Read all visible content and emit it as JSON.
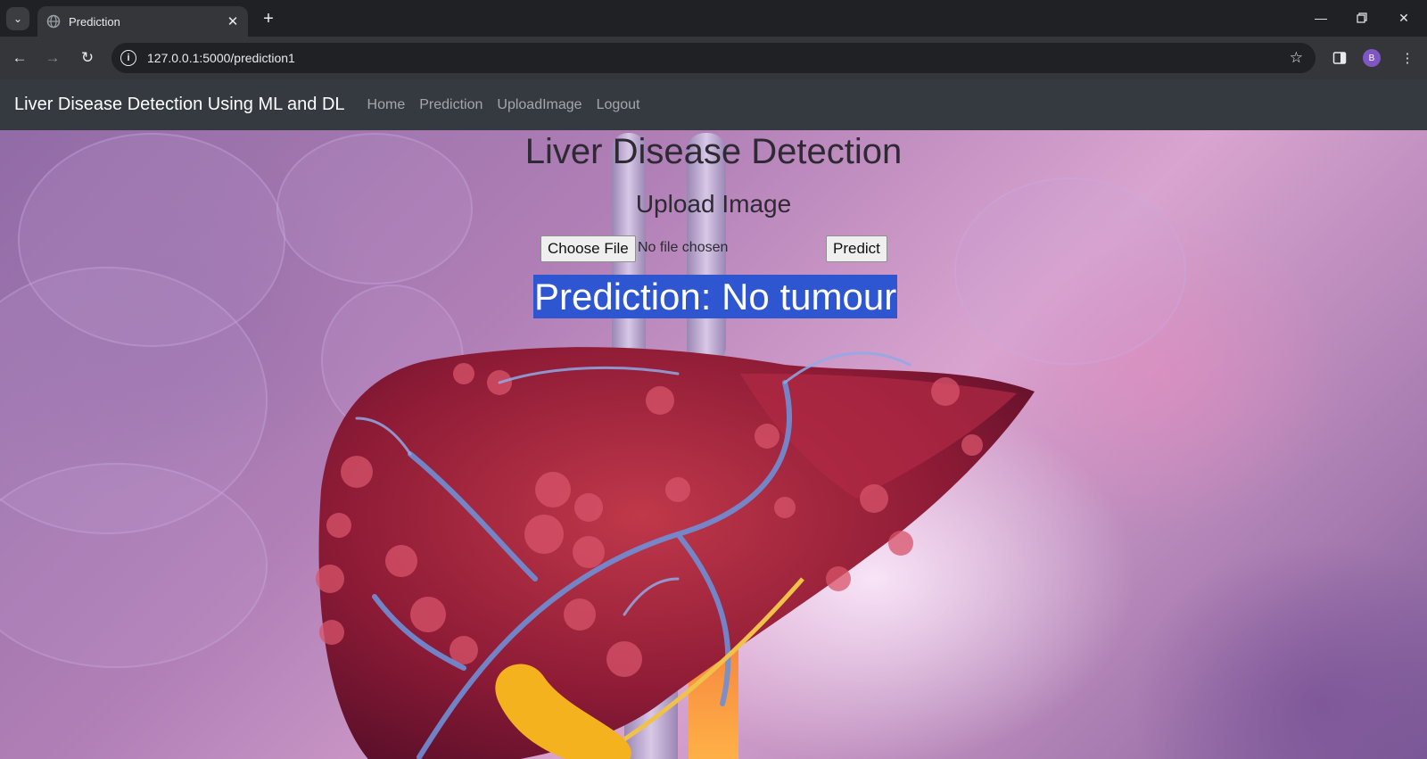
{
  "browser": {
    "tab_title": "Prediction",
    "url": "127.0.0.1:5000/prediction1",
    "profile_initial": "B"
  },
  "navbar": {
    "brand": "Liver Disease Detection Using ML and DL",
    "links": [
      "Home",
      "Prediction",
      "UploadImage",
      "Logout"
    ]
  },
  "main": {
    "title": "Liver Disease Detection",
    "subtitle": "Upload Image",
    "file_button": "Choose File",
    "file_status": "No file chosen",
    "predict_button": "Predict",
    "result": "Prediction: No tumour"
  },
  "colors": {
    "navbar_bg": "#343a40",
    "result_highlight": "#2f56d1",
    "browser_frame": "#202124"
  }
}
